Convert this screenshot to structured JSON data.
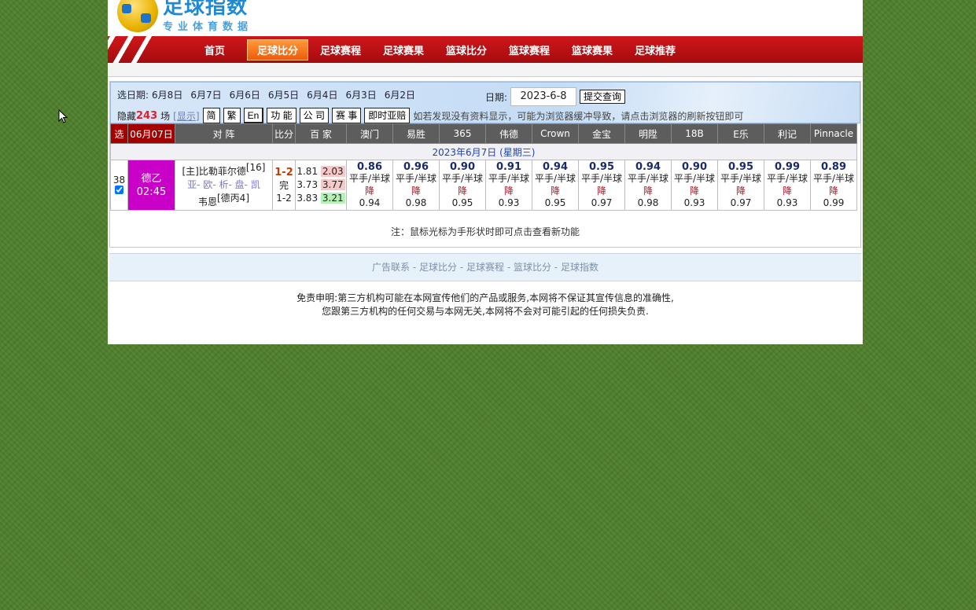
{
  "logo": {
    "title": "足球指数",
    "subtitle": "专业体育数据"
  },
  "nav": [
    "首页",
    "足球比分",
    "足球赛程",
    "足球赛果",
    "篮球比分",
    "篮球赛程",
    "篮球赛果",
    "足球推荐"
  ],
  "nav_active": 1,
  "panel": {
    "select_date_label": "选日期:",
    "dates": [
      "6月8日",
      "6月7日",
      "6月6日",
      "6月5日",
      "6月4日",
      "6月3日",
      "6月2日"
    ],
    "date_label": "日期:",
    "date_value": "2023-6-8",
    "submit": "提交查询",
    "hidden_prefix": "隐藏",
    "hidden_count": "243",
    "hidden_suffix": "场",
    "show": "[显示]",
    "buttons": [
      "简",
      "繁",
      "En",
      "功 能",
      "公 司",
      "赛 事",
      "即时亚赔"
    ],
    "notice": "如若发现没有资料显示，可能为浏览器缓冲导致，请点击浏览器的刷新按钮即可"
  },
  "table": {
    "headers": {
      "select": "选",
      "date": "06月07日",
      "match": "对 阵",
      "score": "比分",
      "baijia": "百 家"
    },
    "bookmakers": [
      "澳门",
      "易胜",
      "365",
      "伟德",
      "Crown",
      "金宝",
      "明陞",
      "18B",
      "E乐",
      "利记",
      "Pinnacle"
    ],
    "date_row": "2023年6月7日 (星期三)",
    "match": {
      "num": "38",
      "checked": true,
      "league": "德乙",
      "time": "02:45",
      "home": "[主]比勒菲尔德",
      "home_rank": "[16]",
      "links": [
        "亚",
        "欧",
        "析",
        "盘",
        "凯"
      ],
      "away": "韦恩",
      "away_rank": "[德丙4]",
      "score": "1-2",
      "status": "完",
      "half": "1-2",
      "baijia": [
        [
          "1.81",
          "2.03"
        ],
        [
          "3.73",
          "3.77"
        ],
        [
          "3.83",
          "3.21"
        ]
      ],
      "odds": [
        {
          "home": "0.86",
          "line": "平手/半球",
          "dir": "降",
          "away": "0.94"
        },
        {
          "home": "0.96",
          "line": "平手/半球",
          "dir": "降",
          "away": "0.98"
        },
        {
          "home": "0.90",
          "line": "平手/半球",
          "dir": "降",
          "away": "0.95"
        },
        {
          "home": "0.91",
          "line": "平手/半球",
          "dir": "降",
          "away": "0.93"
        },
        {
          "home": "0.94",
          "line": "平手/半球",
          "dir": "降",
          "away": "0.95"
        },
        {
          "home": "0.95",
          "line": "平手/半球",
          "dir": "降",
          "away": "0.97"
        },
        {
          "home": "0.94",
          "line": "平手/半球",
          "dir": "降",
          "away": "0.98"
        },
        {
          "home": "0.90",
          "line": "平手/半球",
          "dir": "降",
          "away": "0.93"
        },
        {
          "home": "0.95",
          "line": "平手/半球",
          "dir": "降",
          "away": "0.97"
        },
        {
          "home": "0.99",
          "line": "平手/半球",
          "dir": "降",
          "away": "0.93"
        },
        {
          "home": "0.89",
          "line": "平手/半球",
          "dir": "降",
          "away": "0.99"
        }
      ]
    }
  },
  "tip": "注：鼠标光标为手形状时即可点击查看新功能",
  "footer_links": [
    "广告联系",
    "足球比分",
    "足球赛程",
    "篮球比分",
    "足球指数"
  ],
  "disclaimer": [
    "免责申明:第三方机构可能在本网宣传他们的产品或服务,本网将不保证其宣传信息的准确性,",
    "您跟第三方机构的任何交易与本网无关,本网将不会对可能引起的任何损失负责."
  ]
}
